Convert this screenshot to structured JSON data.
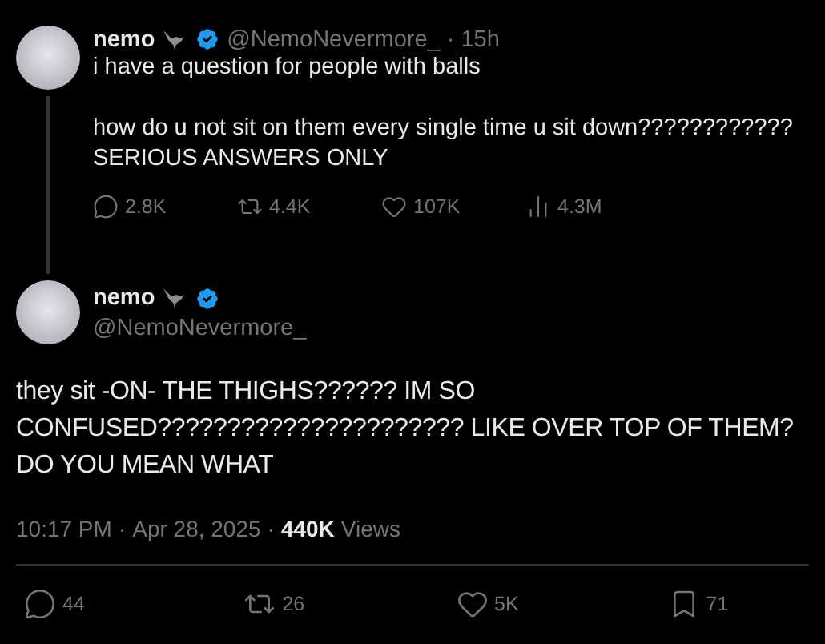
{
  "parent_tweet": {
    "display_name": "nemo",
    "handle": "@NemoNevermore_",
    "separator": "·",
    "time": "15h",
    "verified": true,
    "text": "i have a question for people with balls\n\nhow do u not sit on them every single time u sit down????????????\nSERIOUS ANSWERS ONLY",
    "actions": [
      {
        "kind": "reply",
        "count": "2.8K"
      },
      {
        "kind": "repost",
        "count": "4.4K"
      },
      {
        "kind": "like",
        "count": "107K"
      },
      {
        "kind": "views",
        "count": "4.3M"
      }
    ]
  },
  "reply_tweet": {
    "display_name": "nemo",
    "handle": "@NemoNevermore_",
    "verified": true,
    "text": "they sit -ON- THE THIGHS?????? IM SO\nCONFUSED?????????????????????? LIKE OVER TOP OF THEM?\nDO YOU MEAN WHAT",
    "time": "10:17 PM",
    "separator_1": "·",
    "date": "Apr 28, 2025",
    "separator_2": "·",
    "views_count": "440K",
    "views_label": "Views",
    "actions": [
      {
        "kind": "reply",
        "count": "44"
      },
      {
        "kind": "repost",
        "count": "26"
      },
      {
        "kind": "like",
        "count": "5K"
      },
      {
        "kind": "bookmark",
        "count": "71"
      }
    ]
  }
}
